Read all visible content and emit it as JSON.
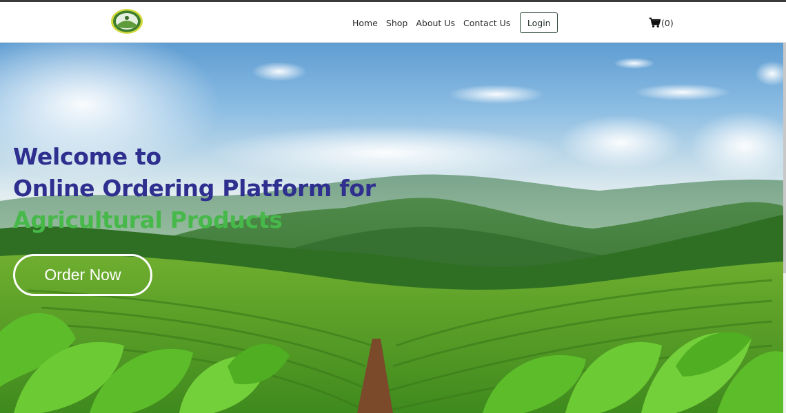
{
  "nav": {
    "logo_icon": "organization-seal-logo",
    "links": [
      "Home",
      "Shop",
      "About Us",
      "Contact Us"
    ],
    "login_label": "Login",
    "cart_icon": "shopping-cart-icon",
    "cart_count": "(0)"
  },
  "hero": {
    "title_line1": "Welcome to",
    "title_line2": "Online Ordering Platform for",
    "title_line3": "Agricultural Products",
    "cta_label": "Order Now",
    "colors": {
      "title": "#2e2f8e",
      "highlight": "#47b84a",
      "cta": "#ffffff"
    },
    "background": "farm-landscape-image"
  }
}
